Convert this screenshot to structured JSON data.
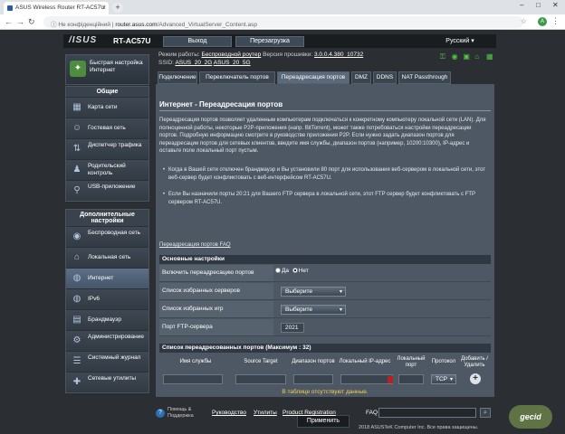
{
  "browser": {
    "tab_title": "ASUS Wireless Router RT-AC57U",
    "tab_close": "×",
    "new_tab": "+",
    "security_label": "Не конфіденційний",
    "url_host": "router.asus.com",
    "url_path": "/Advanced_VirtualServer_Content.asp",
    "profile_initial": "A"
  },
  "header": {
    "logo": "/ISUS",
    "model": "RT-AC57U",
    "logout": "Выход",
    "reboot": "Перезагрузка",
    "language": "Русский ▾"
  },
  "status": {
    "mode_label": "Режим работы:",
    "mode_value": "Беспроводной роутер",
    "version_label": "Версия прошивки:",
    "version_value": "3.0.0.4.380_10732",
    "ssid_label": "SSID:",
    "ssid_1": "ASUS_20_2G",
    "ssid_2": "ASUS_20_5G"
  },
  "sidebar": {
    "qis_label": "Быстрая настройка Интернет",
    "general_title": "Общие",
    "general": [
      {
        "label": "Карта сети",
        "icon": "map-icon",
        "glyph": "▦"
      },
      {
        "label": "Гостевая сеть",
        "icon": "guest-network-icon",
        "glyph": "☺"
      },
      {
        "label": "Диспетчер трафика",
        "icon": "traffic-icon",
        "glyph": "⇅"
      },
      {
        "label": "Родительский контроль",
        "icon": "parental-icon",
        "glyph": "♟"
      },
      {
        "label": "USB-приложение",
        "icon": "usb-icon",
        "glyph": "⚲"
      }
    ],
    "advanced_title": "Дополнительные настройки",
    "advanced": [
      {
        "label": "Беспроводная сеть",
        "icon": "wireless-icon",
        "glyph": "◉"
      },
      {
        "label": "Локальная сеть",
        "icon": "lan-icon",
        "glyph": "⌂"
      },
      {
        "label": "Интернет",
        "icon": "globe-icon",
        "glyph": "◍"
      },
      {
        "label": "IPv6",
        "icon": "ipv6-icon",
        "glyph": "◍"
      },
      {
        "label": "Брандмауэр",
        "icon": "firewall-icon",
        "glyph": "▤"
      },
      {
        "label": "Администрирование",
        "icon": "admin-icon",
        "glyph": "⚙"
      },
      {
        "label": "Системный журнал",
        "icon": "log-icon",
        "glyph": "☰"
      },
      {
        "label": "Сетевые утилиты",
        "icon": "tools-icon",
        "glyph": "✚"
      }
    ]
  },
  "tabs": [
    {
      "label": "Подключение"
    },
    {
      "label": "Переключатель портов"
    },
    {
      "label": "Переадресация портов"
    },
    {
      "label": "DMZ"
    },
    {
      "label": "DDNS"
    },
    {
      "label": "NAT Passthrough"
    }
  ],
  "content": {
    "title": "Интернет - Переадресация портов",
    "description": "Переадресация портов позволяет удаленным компьютерам подключаться к конкретному компьютеру локальной сети (LAN). Для полноценной работы, некоторые P2P-приложения (напр. BitTorrent), может также потребоваться настройки переадресации портов. Подробную информацию смотрите в руководстве приложения P2P. Если нужно задать диапазон портов для переадресации портов для сетевых клиентов, введите имя службы, диапазон портов (например, 10200:10300), IP-адрес и оставьте поле локальный порт пустым.",
    "bullet_1": "Когда в Вашей сети отключен брандмауэр и Вы установили 80 порт для использования веб-сервером в локальной сети, этот веб-сервер будет конфликтовать с веб-интерфейсом RT-AC57U.",
    "bullet_2": "Если Вы назначили порты 20:21 для Вашего FTP сервера в локальной сети, этот FTP сервер будет конфликтовать с FTP сервером RT-AC57U.",
    "faq": "Переадресация портов FAQ"
  },
  "basic": {
    "header": "Основные настройки",
    "enable_label": "Включить переадресацию портов",
    "yes": "Да",
    "no": "Нет",
    "servers_label": "Список избранных серверов",
    "servers_value": "Выберите",
    "games_label": "Список избранных игр",
    "games_value": "Выберите",
    "ftp_label": "Порт FTP-сервера",
    "ftp_value": "2021"
  },
  "list": {
    "header": "Список переадресованных портов (Максимум : 32)",
    "columns": [
      "Имя службы",
      "Source Target",
      "Диапазон портов",
      "Локальный IP-адрес",
      "Локальный порт",
      "Протокол",
      "Добавить / Удалить"
    ],
    "protocol_value": "TCP",
    "add_symbol": "+",
    "empty_message": "В таблице отсутствуют данные.",
    "apply": "Применить"
  },
  "footer": {
    "help": "Помощь & Поддержка",
    "manual": "Руководство",
    "utilities": "Утилиты",
    "product_registration": "Product Registration",
    "faq": "FAQ",
    "copyright": "2018 ASUSTeK Computer Inc. Все права защищены."
  },
  "watermark": "gecid"
}
